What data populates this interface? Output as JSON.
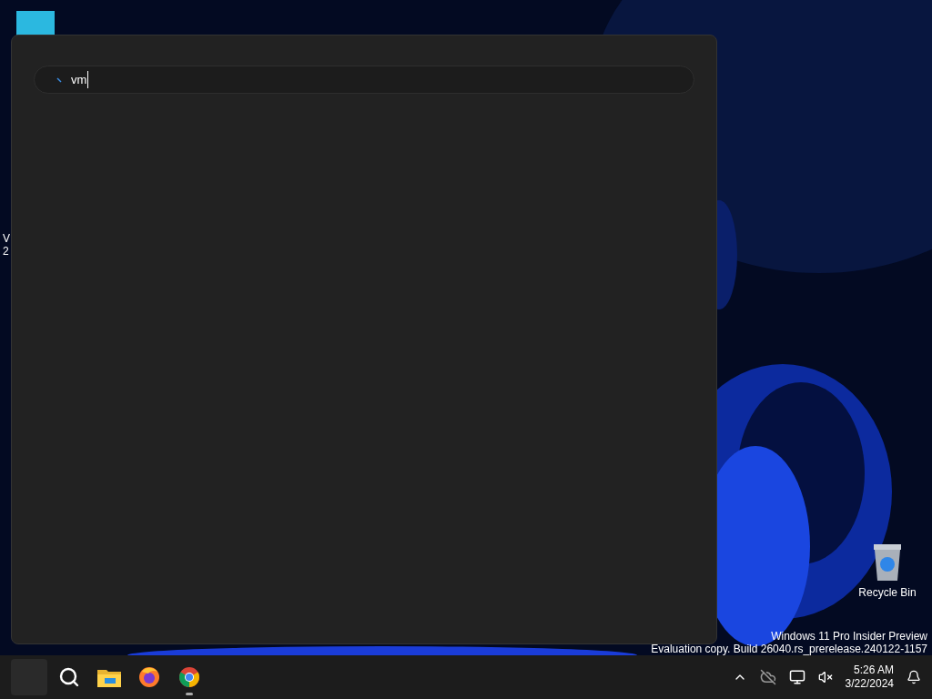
{
  "desktop": {
    "icons": [
      {
        "label": "Recycle Bin"
      }
    ],
    "partial_label_lines": [
      "V",
      "2"
    ],
    "watermark": [
      "Windows 11 Pro Insider Preview",
      "Evaluation copy. Build 26040.rs_prerelease.240122-1157"
    ]
  },
  "search_panel": {
    "query": "vm",
    "loading": true
  },
  "taskbar": {
    "apps": [
      {
        "kind": "start",
        "running": false
      },
      {
        "kind": "search",
        "running": false
      },
      {
        "kind": "explorer",
        "running": false
      },
      {
        "kind": "firefox",
        "running": false
      },
      {
        "kind": "chrome",
        "running": true
      }
    ],
    "clock": {
      "time": "5:26 AM",
      "date": "3/22/2024"
    }
  }
}
